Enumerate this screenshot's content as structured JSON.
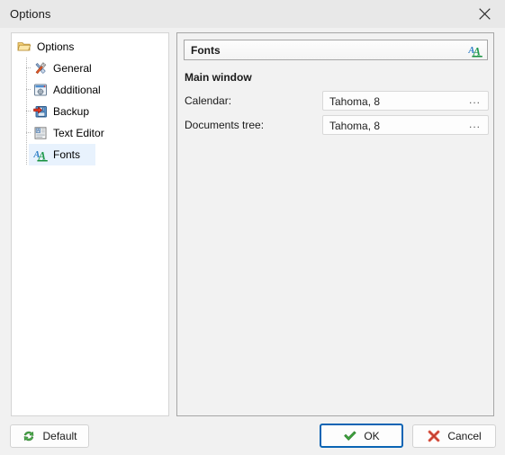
{
  "window": {
    "title": "Options",
    "close_icon": "close-icon"
  },
  "tree": {
    "root": {
      "label": "Options",
      "icon": "folder-open-icon"
    },
    "items": [
      {
        "label": "General",
        "icon": "tools-icon",
        "selected": false
      },
      {
        "label": "Additional",
        "icon": "settings-window-icon",
        "selected": false
      },
      {
        "label": "Backup",
        "icon": "floppy-save-icon",
        "selected": false
      },
      {
        "label": "Text Editor",
        "icon": "text-document-icon",
        "selected": false
      },
      {
        "label": "Fonts",
        "icon": "fonts-aa-icon",
        "selected": true
      }
    ]
  },
  "content": {
    "header": {
      "title": "Fonts",
      "icon": "fonts-aa-icon"
    },
    "group_title": "Main window",
    "fields": [
      {
        "label": "Calendar:",
        "value": "Tahoma, 8",
        "browse_label": "..."
      },
      {
        "label": "Documents tree:",
        "value": "Tahoma, 8",
        "browse_label": "..."
      }
    ]
  },
  "footer": {
    "default_label": "Default",
    "default_icon": "refresh-arrows-icon",
    "ok_label": "OK",
    "ok_icon": "green-check-icon",
    "cancel_label": "Cancel",
    "cancel_icon": "red-x-icon"
  },
  "colors": {
    "accent_focus": "#0a64b4",
    "selection": "#e8f2fd",
    "panel_bg": "#f2f2f2",
    "titlebar_bg": "#e8e8e8"
  }
}
